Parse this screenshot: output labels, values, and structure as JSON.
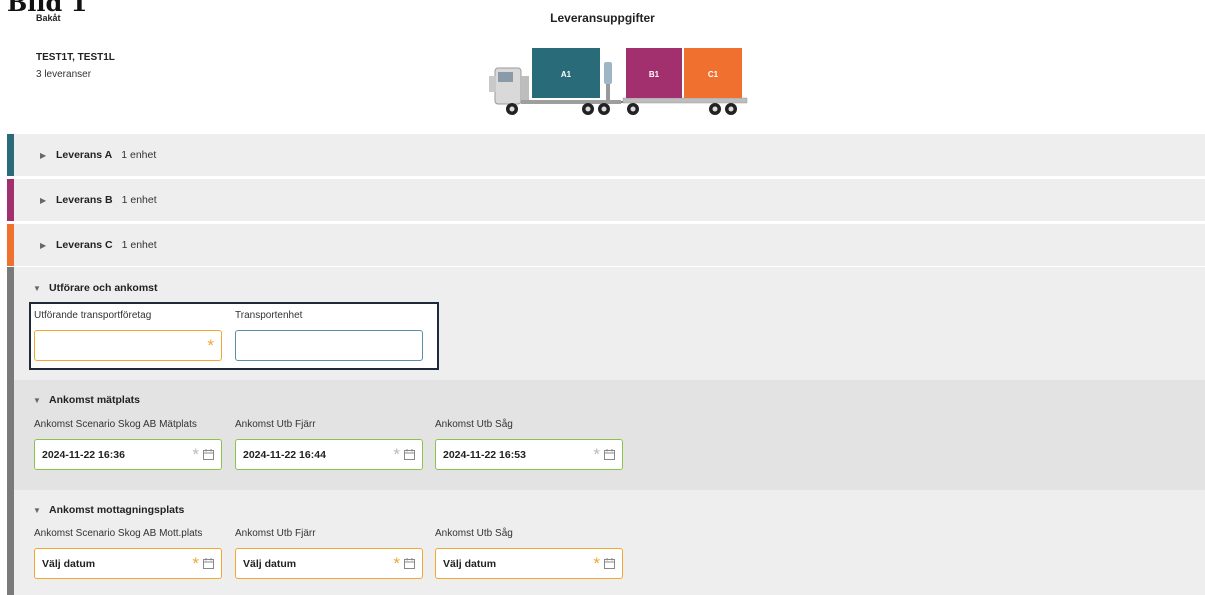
{
  "figure_label": "Bild 1",
  "header": {
    "back_label": "Bakåt",
    "title": "Leveransuppgifter",
    "vehicle_id": "TEST1T, TEST1L",
    "delivery_count": "3 leveranser"
  },
  "truck": {
    "loads": [
      {
        "label": "A1",
        "color": "#2a6b7a"
      },
      {
        "label": "B1",
        "color": "#a3306e"
      },
      {
        "label": "C1",
        "color": "#f07030"
      }
    ]
  },
  "deliveries": [
    {
      "name": "Leverans A",
      "units": "1 enhet",
      "color": "#2a6b7a"
    },
    {
      "name": "Leverans B",
      "units": "1 enhet",
      "color": "#a3306e"
    },
    {
      "name": "Leverans C",
      "units": "1 enhet",
      "color": "#f07030"
    }
  ],
  "executor": {
    "title": "Utförare och ankomst",
    "company_label": "Utförande transportföretag",
    "company_value": "",
    "unit_label": "Transportenhet",
    "unit_value": ""
  },
  "measure_arrival": {
    "title": "Ankomst mätplats",
    "fields": [
      {
        "label": "Ankomst Scenario Skog AB Mätplats",
        "value": "2024-11-22 16:36"
      },
      {
        "label": "Ankomst Utb Fjärr",
        "value": "2024-11-22 16:44"
      },
      {
        "label": "Ankomst Utb Såg",
        "value": "2024-11-22 16:53"
      }
    ]
  },
  "receive_arrival": {
    "title": "Ankomst mottagningsplats",
    "fields": [
      {
        "label": "Ankomst Scenario Skog AB Mott.plats",
        "value": "Välj datum"
      },
      {
        "label": "Ankomst Utb Fjärr",
        "value": "Välj datum"
      },
      {
        "label": "Ankomst Utb Såg",
        "value": "Välj datum"
      }
    ]
  },
  "colors": {
    "required_active": "#f0a830",
    "required_inactive": "#bbbbbb",
    "focus_border": "#1e2a38"
  }
}
